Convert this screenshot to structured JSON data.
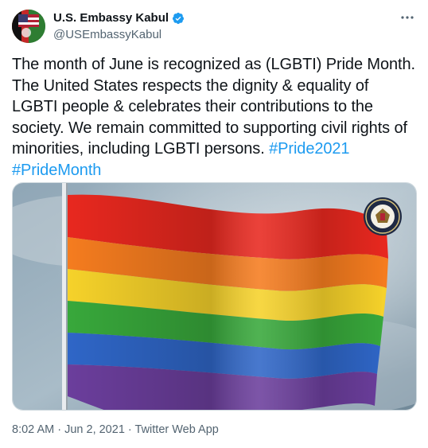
{
  "author": {
    "display_name": "U.S. Embassy Kabul",
    "handle": "@USEmbassyKabul",
    "verified": true,
    "avatar_icon": "embassy-flag-avatar-icon"
  },
  "tweet": {
    "text": "The month of June is recognized as (LGBTI) Pride Month. The United States respects the dignity & equality of LGBTI people & celebrates their contributions to the society. We remain committed to supporting civil rights of minorities, including LGBTI persons.",
    "hashtags": [
      "#Pride2021",
      "#PrideMonth"
    ]
  },
  "media": {
    "description_icon": "rainbow-pride-flag-image",
    "seal_icon": "state-department-seal-icon",
    "colors": [
      "#e8281f",
      "#f57c1f",
      "#f6d22a",
      "#38a83b",
      "#2f66c7",
      "#6b3e9c"
    ]
  },
  "meta": {
    "time": "8:02 AM",
    "separator": " · ",
    "date": "Jun 2, 2021",
    "source": "Twitter Web App"
  },
  "more_icon": "more-options-icon",
  "verified_icon": "verified-badge-icon",
  "accent_color": "#1d9bf0"
}
